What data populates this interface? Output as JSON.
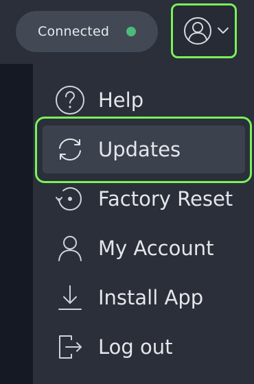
{
  "header": {
    "status": {
      "label": "Connected",
      "indicator_color": "#4cba78"
    },
    "account_button": {
      "avatar_icon": "user-circle-icon",
      "chevron_icon": "chevron-down-icon"
    }
  },
  "menu": {
    "items": [
      {
        "label": "Help",
        "icon": "help-circle-icon"
      },
      {
        "label": "Updates",
        "icon": "refresh-icon",
        "selected": true
      },
      {
        "label": "Factory Reset",
        "icon": "reset-icon"
      },
      {
        "label": "My Account",
        "icon": "user-icon"
      },
      {
        "label": "Install App",
        "icon": "download-icon"
      },
      {
        "label": "Log out",
        "icon": "logout-icon"
      }
    ]
  },
  "colors": {
    "accent_highlight": "#7cf25a",
    "topbar_bg": "#2a2f3a",
    "menu_bg": "#2a2f3a",
    "selected_item_bg": "#3b414d",
    "text": "#e4e6ea"
  }
}
